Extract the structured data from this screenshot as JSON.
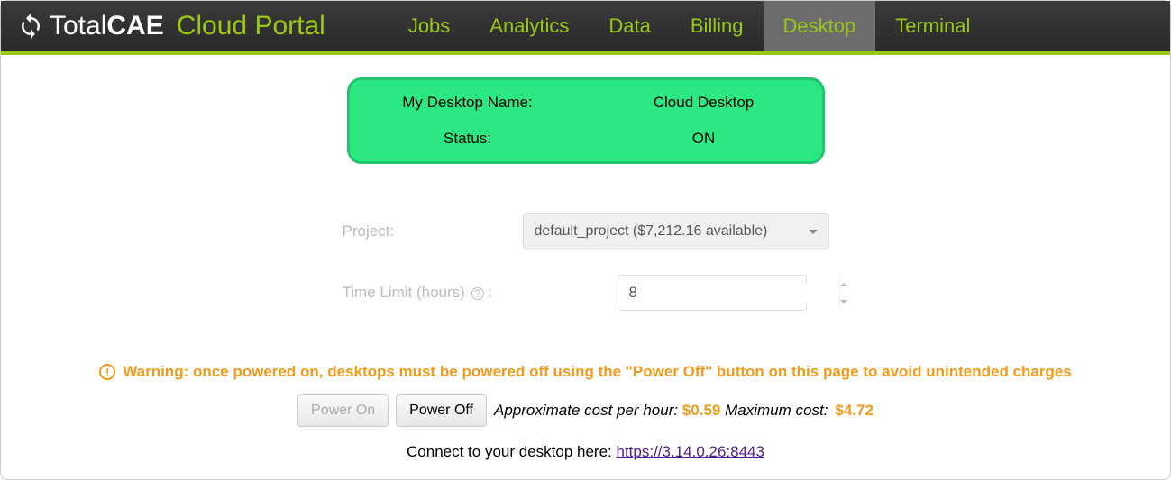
{
  "brand": {
    "prefix": "Total",
    "bold": "CAE",
    "sub": "Cloud Portal"
  },
  "nav": {
    "items": [
      "Jobs",
      "Analytics",
      "Data",
      "Billing",
      "Desktop",
      "Terminal"
    ],
    "active": "Desktop"
  },
  "status_box": {
    "name_label": "My Desktop Name:",
    "name_value": "Cloud Desktop",
    "status_label": "Status:",
    "status_value": "ON"
  },
  "form": {
    "project_label": "Project:",
    "project_value": "default_project ($7,212.16 available)",
    "time_label": "Time Limit (hours)",
    "time_help": "?",
    "time_value": "8"
  },
  "warning": {
    "icon": "!",
    "text": "Warning: once powered on, desktops must be powered off using the \"Power Off\" button on this page to avoid unintended charges"
  },
  "controls": {
    "power_on": "Power On",
    "power_off": "Power Off",
    "approx_label": "Approximate cost per hour:",
    "approx_value": "$0.59",
    "max_label": "Maximum cost:",
    "max_value": "$4.72"
  },
  "connect": {
    "label": "Connect to your desktop here: ",
    "url": "https://3.14.0.26:8443"
  }
}
